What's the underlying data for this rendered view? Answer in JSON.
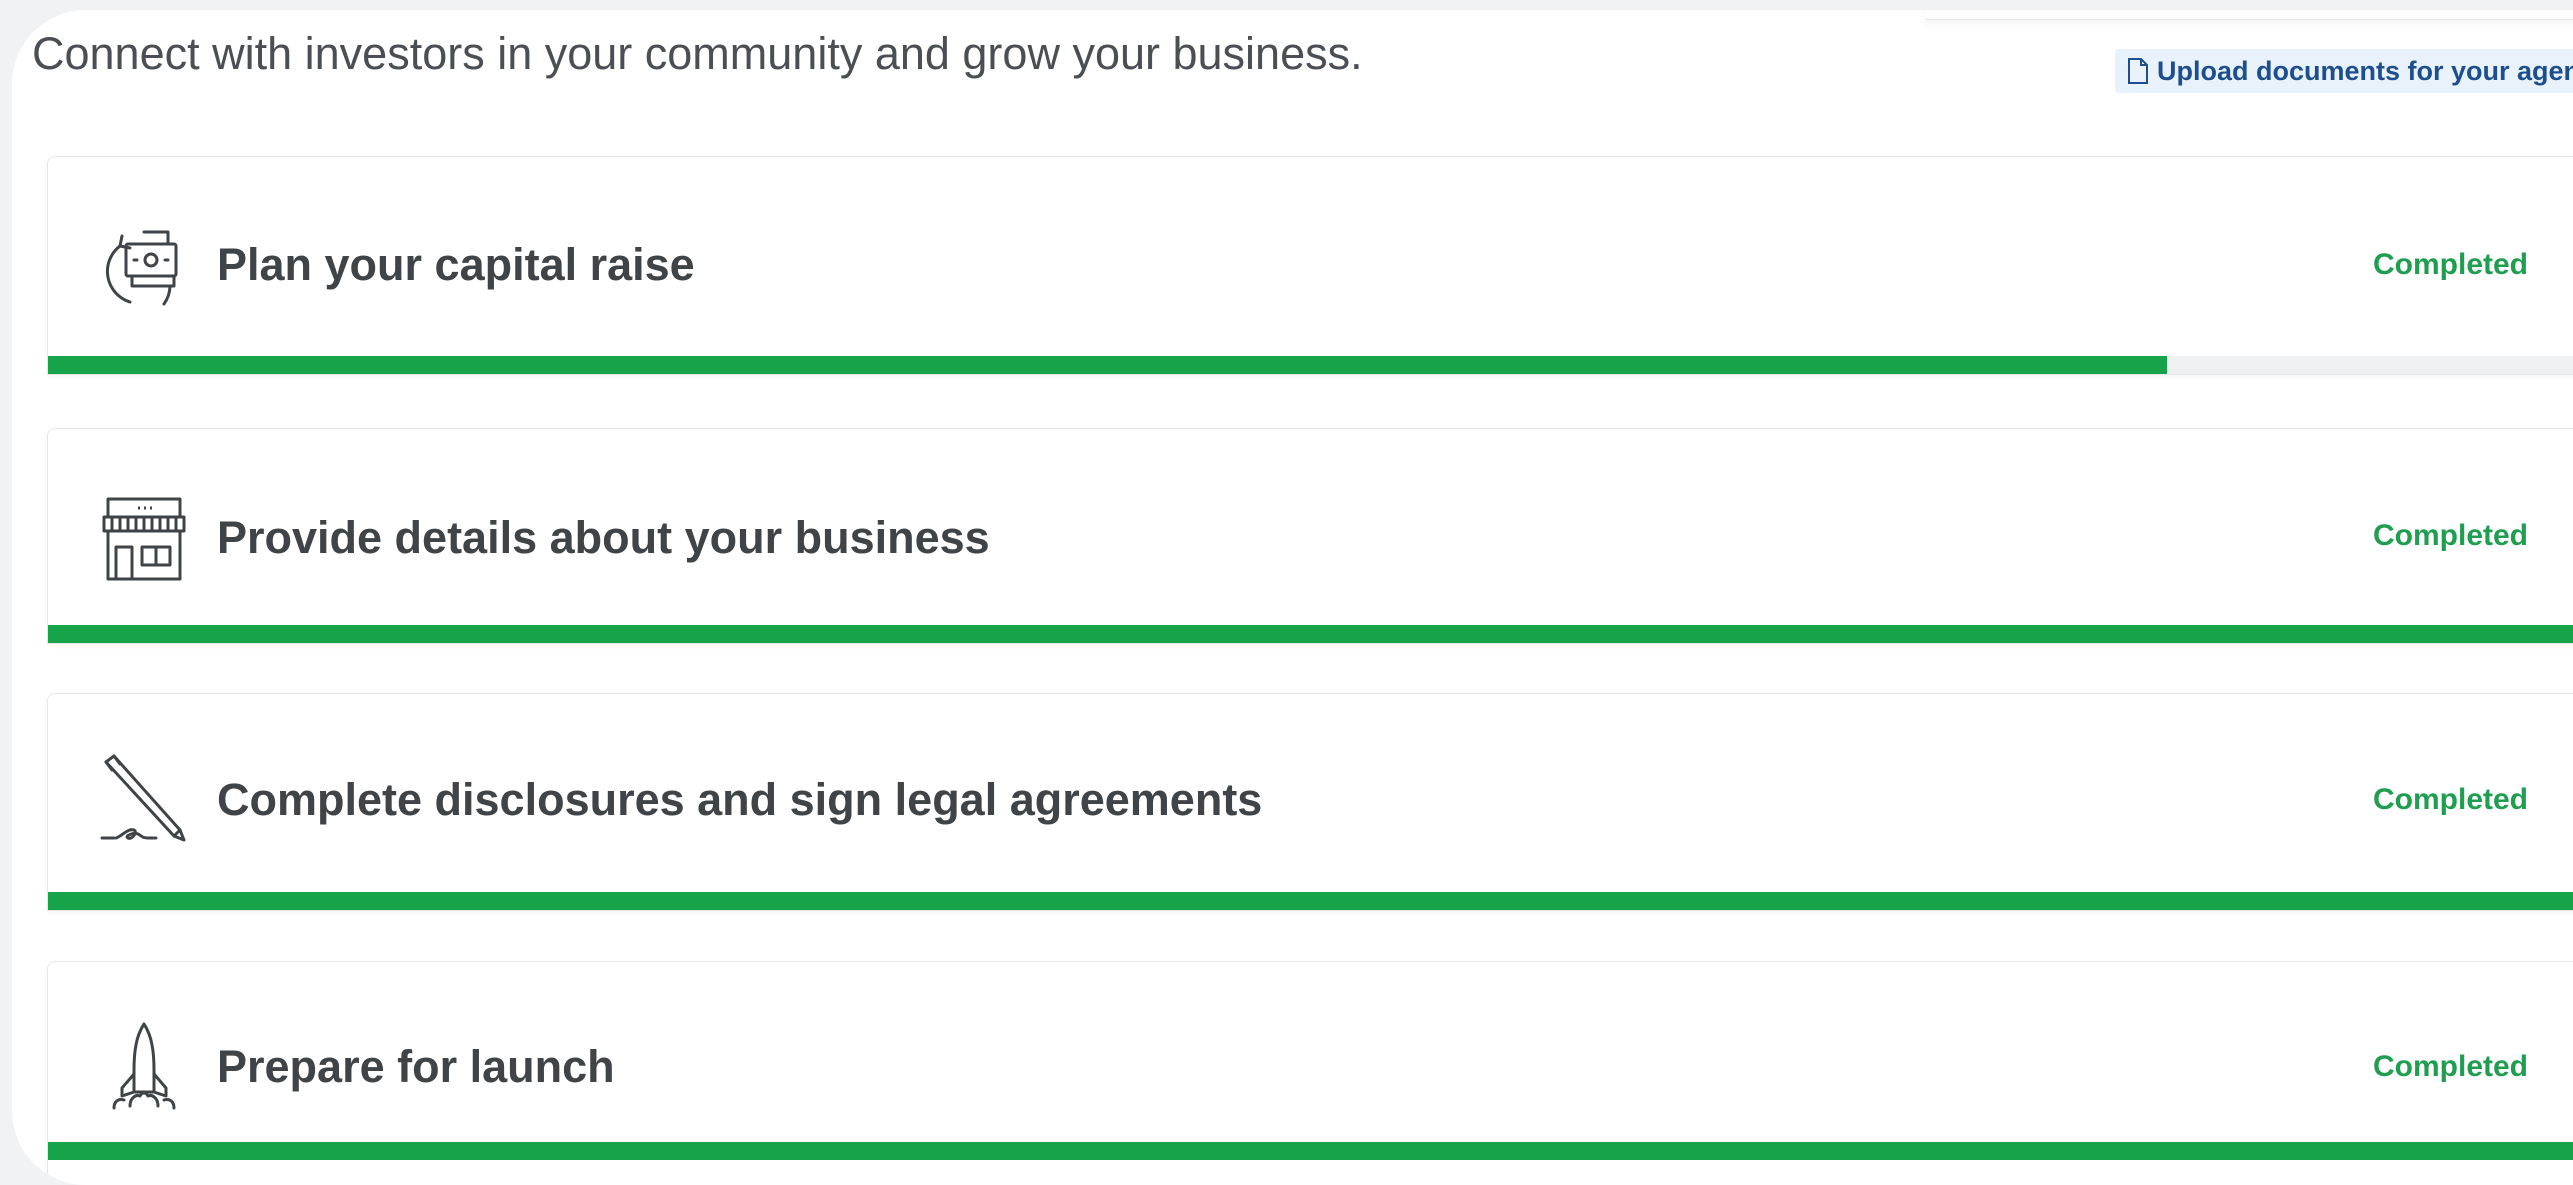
{
  "header": {
    "subtitle": "Connect with investors in your community and grow your business.",
    "upload_link": "Upload documents for your agent",
    "upload_icon": "document-icon"
  },
  "colors": {
    "completed_text": "#1f9e50",
    "progress_fill": "#16a34a",
    "upload_link_bg": "#e9f2fb",
    "upload_link_text": "#1d4f8f"
  },
  "steps": [
    {
      "title": "Plan your capital raise",
      "status": "Completed",
      "icon": "money-cycle-icon",
      "progress": 0.835
    },
    {
      "title": "Provide details about your business",
      "status": "Completed",
      "icon": "storefront-icon",
      "progress": 1.0
    },
    {
      "title": "Complete disclosures and sign legal agreements",
      "status": "Completed",
      "icon": "pen-signature-icon",
      "progress": 1.0
    },
    {
      "title": "Prepare for launch",
      "status": "Completed",
      "icon": "rocket-icon",
      "progress": 1.0
    }
  ]
}
